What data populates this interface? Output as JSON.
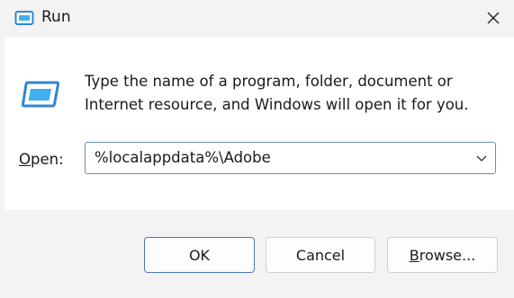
{
  "window": {
    "title": "Run",
    "icon": "run-icon",
    "close_icon": "close-icon"
  },
  "message": {
    "line1": "Type the name of a program, folder, document or",
    "line2": "Internet resource, and Windows will open it for you."
  },
  "open_field": {
    "label_first": "O",
    "label_rest": "pen:",
    "value": "%localappdata%\\Adobe"
  },
  "buttons": {
    "ok": "OK",
    "cancel": "Cancel",
    "browse_first": "B",
    "browse_rest": "rowse..."
  },
  "colors": {
    "accent": "#4a7ab3",
    "icon_blue": "#2f86d4"
  }
}
